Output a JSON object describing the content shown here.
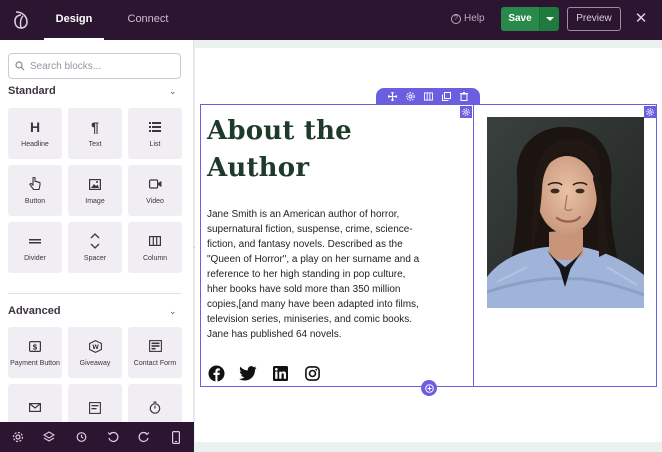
{
  "topbar": {
    "tabs": [
      {
        "label": "Design",
        "active": true
      },
      {
        "label": "Connect",
        "active": false
      }
    ],
    "help_label": "Help",
    "save_label": "Save",
    "preview_label": "Preview"
  },
  "sidebar": {
    "search_placeholder": "Search blocks...",
    "standard_title": "Standard",
    "standard_blocks": [
      {
        "label": "Headline",
        "icon": "headline-icon"
      },
      {
        "label": "Text",
        "icon": "paragraph-icon"
      },
      {
        "label": "List",
        "icon": "list-icon"
      },
      {
        "label": "Button",
        "icon": "pointer-hand-icon"
      },
      {
        "label": "Image",
        "icon": "image-icon"
      },
      {
        "label": "Video",
        "icon": "video-icon"
      },
      {
        "label": "Divider",
        "icon": "divider-icon"
      },
      {
        "label": "Spacer",
        "icon": "spacer-icon"
      },
      {
        "label": "Column",
        "icon": "column-icon"
      }
    ],
    "advanced_title": "Advanced",
    "advanced_blocks": [
      {
        "label": "Payment Button",
        "icon": "payment-icon"
      },
      {
        "label": "Giveaway",
        "icon": "giveaway-icon"
      },
      {
        "label": "Contact Form",
        "icon": "contact-form-icon"
      },
      {
        "label": "",
        "icon": "email-icon"
      },
      {
        "label": "",
        "icon": "form-icon"
      },
      {
        "label": "",
        "icon": "stopwatch-icon"
      }
    ]
  },
  "bottom_toolbar": [
    "settings-icon",
    "layers-icon",
    "history-icon",
    "undo-icon",
    "redo-icon",
    "mobile-preview-icon"
  ],
  "content": {
    "heading": "About the Author",
    "bio": "Jane Smith is an American author of horror, supernatural fiction, suspense, crime, science-fiction, and fantasy novels. Described as the \"Queen of Horror\", a play on her surname and a reference to her high standing in pop culture, hher books have sold more than 350 million copies,[and many have been adapted into films, television series, miniseries, and comic books. Jane has published 64 novels.",
    "socials": [
      "facebook-icon",
      "twitter-icon",
      "linkedin-icon",
      "instagram-icon"
    ]
  },
  "colors": {
    "topbar_bg": "#2b1531",
    "save_green": "#29894b",
    "editor_accent": "#6b5fe0",
    "heading_color": "#1e3b2a"
  }
}
